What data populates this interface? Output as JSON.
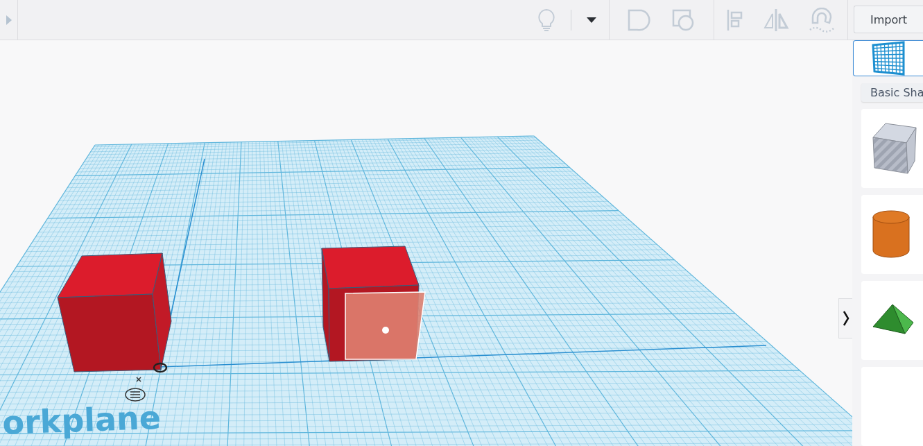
{
  "toolbar": {
    "import_button": "Import"
  },
  "shape_panel": {
    "category": "Basic Sha",
    "shapes": [
      {
        "kind": "box"
      },
      {
        "kind": "cylinder"
      },
      {
        "kind": "roof"
      },
      {
        "kind": "partial"
      }
    ]
  },
  "workplane": {
    "label": "orkplane"
  }
}
